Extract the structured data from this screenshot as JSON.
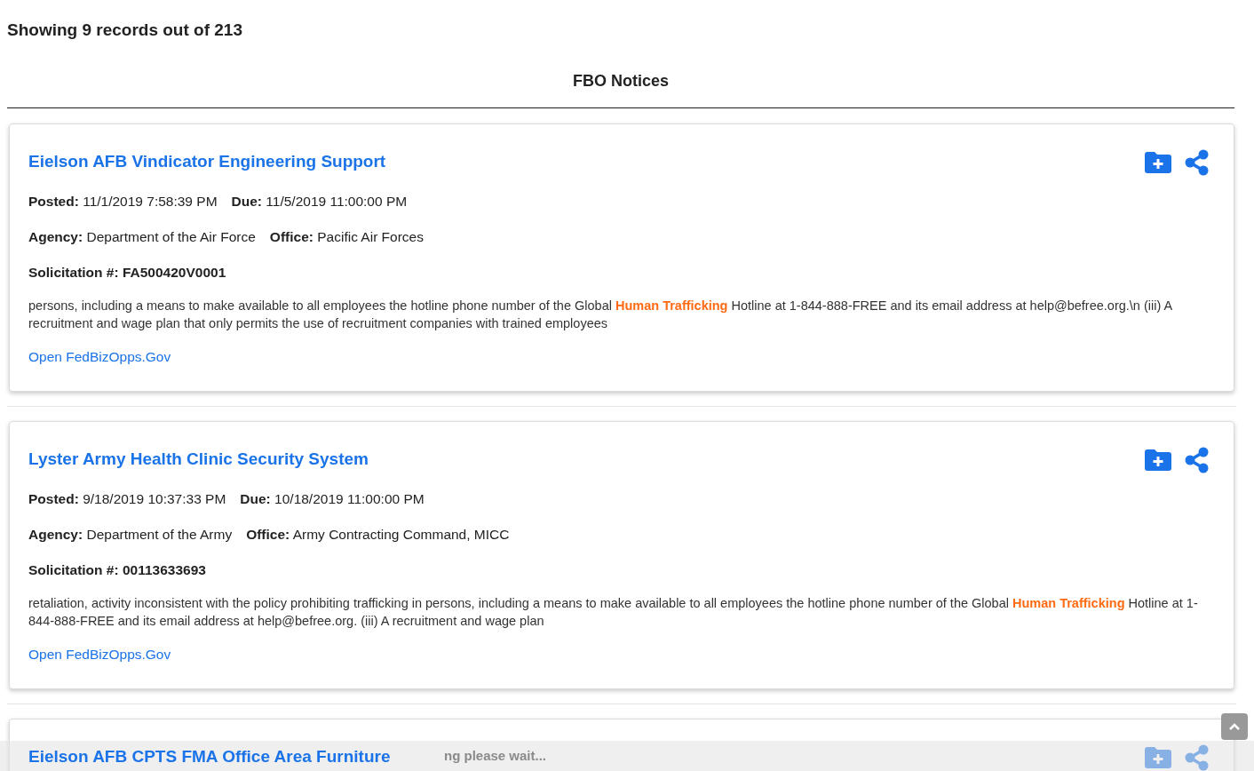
{
  "summary": "Showing 9 records out of 213",
  "heading": "FBO Notices",
  "notices": [
    {
      "title": "Eielson AFB Vindicator Engineering Support",
      "fields": [
        [
          {
            "label": "Posted:",
            "value": "11/1/2019 7:58:39 PM"
          },
          {
            "label": "Due:",
            "value": "11/5/2019 11:00:00 PM"
          }
        ],
        [
          {
            "label": "Agency:",
            "value": "Department of the Air Force"
          },
          {
            "label": "Office:",
            "value": "Pacific Air Forces"
          }
        ]
      ],
      "solicitation": "Solicitation #: FA500420V0001",
      "snippet": [
        {
          "text": "persons, including a means to make available to all employees the hotline phone number of the Global ",
          "highlight": false
        },
        {
          "text": "Human Trafficking",
          "highlight": true
        },
        {
          "text": " Hotline at 1-844-888-FREE and its email address at help@befree.org.\\n (iii) A recruitment and wage plan that only permits the use of recruitment companies with trained employees",
          "highlight": false
        }
      ],
      "link": "Open FedBizOpps.Gov"
    },
    {
      "title": "Lyster Army Health Clinic Security System",
      "fields": [
        [
          {
            "label": "Posted:",
            "value": "9/18/2019 10:37:33 PM"
          },
          {
            "label": "Due:",
            "value": "10/18/2019 11:00:00 PM"
          }
        ],
        [
          {
            "label": "Agency:",
            "value": "Department of the Army"
          },
          {
            "label": "Office:",
            "value": "Army Contracting Command, MICC"
          }
        ]
      ],
      "solicitation": "Solicitation #: 00113633693",
      "snippet": [
        {
          "text": "retaliation, activity inconsistent with the policy prohibiting trafficking in persons, including a means to make available to all employees the hotline phone number of the Global ",
          "highlight": false
        },
        {
          "text": "Human Trafficking",
          "highlight": true
        },
        {
          "text": " Hotline at 1-844-888-FREE and its email address at help@befree.org.   (iii) A recruitment and wage plan",
          "highlight": false
        }
      ],
      "link": "Open FedBizOpps.Gov"
    },
    {
      "title": "Eielson AFB CPTS FMA Office Area Furniture"
    }
  ],
  "loading": "ng please wait..."
}
